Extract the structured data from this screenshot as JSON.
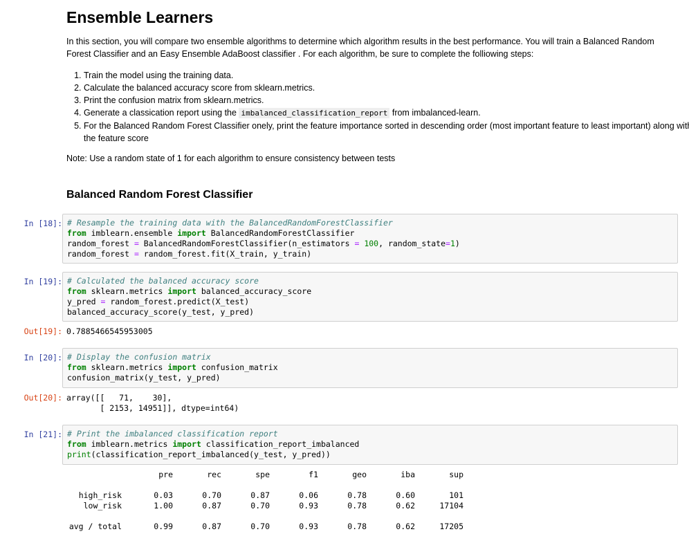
{
  "markdown": {
    "title": "Ensemble Learners",
    "intro": "In this section, you will compare two ensemble algorithms to determine which algorithm results in the best performance. You will train a Balanced Random Forest Classifier and an Easy Ensemble AdaBoost classifier . For each algorithm, be sure to complete the folliowing steps:",
    "steps": [
      "Train the model using the training data.",
      "Calculate the balanced accuracy score from sklearn.metrics.",
      "Print the confusion matrix from sklearn.metrics.",
      "Generate a classication report using the",
      "For the Balanced Random Forest Classifier onely, print the feature importance sorted in descending order (most important feature to least important) along with the feature score"
    ],
    "step4_code": "imbalanced_classification_report",
    "step4_suffix": " from imbalanced-learn.",
    "note": "Note: Use a random state of 1 for each algorithm to ensure consistency between tests",
    "subheading": "Balanced Random Forest Classifier"
  },
  "cells": [
    {
      "prompt": "In [18]:"
    },
    {
      "prompt": "In [19]:",
      "out_prompt": "Out[19]:",
      "output": "0.7885466545953005"
    },
    {
      "prompt": "In [20]:",
      "out_prompt": "Out[20]:",
      "output": "array([[   71,    30],\n       [ 2153, 14951]], dtype=int64)"
    },
    {
      "prompt": "In [21]:"
    }
  ],
  "report": {
    "headers": [
      "pre",
      "rec",
      "spe",
      "f1",
      "geo",
      "iba",
      "sup"
    ],
    "rows": [
      {
        "label": "high_risk",
        "values": [
          "0.03",
          "0.70",
          "0.87",
          "0.06",
          "0.78",
          "0.60",
          "101"
        ]
      },
      {
        "label": "low_risk",
        "values": [
          "1.00",
          "0.87",
          "0.70",
          "0.93",
          "0.78",
          "0.62",
          "17104"
        ]
      },
      {
        "label": "avg / total",
        "values": [
          "0.99",
          "0.87",
          "0.70",
          "0.93",
          "0.78",
          "0.62",
          "17205"
        ]
      }
    ]
  }
}
